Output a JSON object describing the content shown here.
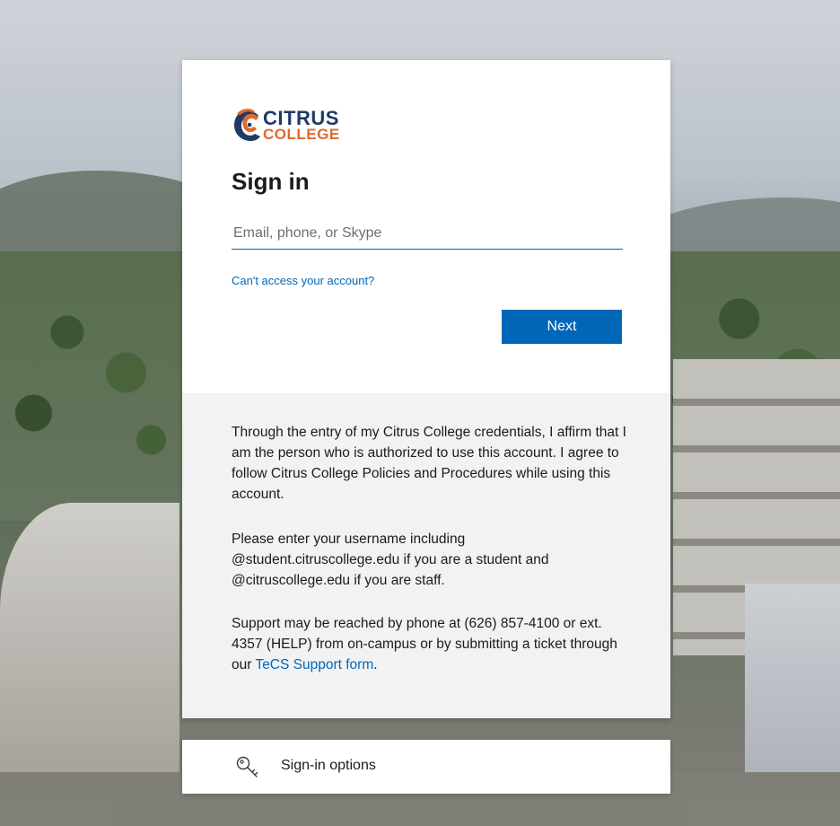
{
  "logo": {
    "line1": "CITRUS",
    "line2": "COLLEGE",
    "brand_blue": "#1f3a63",
    "brand_orange": "#e06a2a"
  },
  "signin": {
    "title": "Sign in",
    "email_placeholder": "Email, phone, or Skype",
    "email_value": "",
    "cant_access_label": "Can't access your account?",
    "next_label": "Next",
    "accent": "#0067b8"
  },
  "info": {
    "para1": "Through the entry of my Citrus College credentials, I affirm that I am the person who is authorized to use this account. I agree to follow Citrus College Policies and Procedures while using this account.",
    "para2": "Please enter your username including @student.citruscollege.edu if you are a student and @citruscollege.edu if you are staff.",
    "para3_prefix": "Support may be reached by phone at (626) 857-4100 or ext. 4357 (HELP) from on-campus or by submitting a ticket through our ",
    "para3_link": "TeCS Support form",
    "para3_suffix": "."
  },
  "signin_options": {
    "icon": "key-icon",
    "label": "Sign-in options"
  }
}
